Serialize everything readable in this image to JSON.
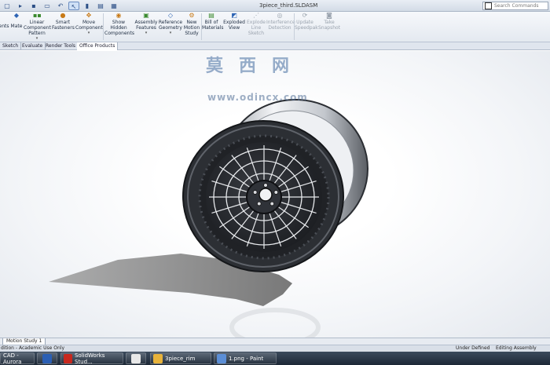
{
  "window": {
    "title": "3piece_third.SLDASM"
  },
  "search": {
    "placeholder": "Search Commands"
  },
  "ribbon": {
    "items": [
      {
        "label": "ents"
      },
      {
        "label": "Mate"
      },
      {
        "label": "Linear Component Pattern"
      },
      {
        "label": "Smart Fasteners"
      },
      {
        "label": "Move Component"
      },
      {
        "label": "Show Hidden Components"
      },
      {
        "label": "Assembly Features"
      },
      {
        "label": "Reference Geometry"
      },
      {
        "label": "New Motion Study"
      },
      {
        "label": "Bill of Materials"
      },
      {
        "label": "Exploded View"
      },
      {
        "label": "Explode Line Sketch"
      },
      {
        "label": "Interference Detection"
      },
      {
        "label": "Update Speedpak"
      },
      {
        "label": "Take Snapshot"
      }
    ]
  },
  "tabs": [
    "Sketch",
    "Evaluate",
    "Render Tools",
    "Office Products"
  ],
  "watermark": {
    "text": "莫西网",
    "url": "www.odincx.com"
  },
  "motion_tab": "Motion Study 1",
  "status": {
    "left": "dition - Academic Use Only",
    "state1": "Under Defined",
    "state2": "Editing Assembly"
  },
  "taskbar": {
    "items": [
      {
        "label": "CAD - Aurora",
        "color": "#3a3a3a"
      },
      {
        "label": "",
        "color": "#2b5fb4"
      },
      {
        "label": "SolidWorks Stud...",
        "color": "#c8281e"
      },
      {
        "label": "",
        "color": "#e8e8e8"
      },
      {
        "label": "3piece_rim",
        "color": "#e8b33b"
      },
      {
        "label": "1.png - Paint",
        "color": "#5b8ed6"
      }
    ]
  },
  "colors": {
    "rim_dark": "#2a2d32",
    "rim_light": "#d7dadf",
    "accent": "#2d64b4"
  }
}
